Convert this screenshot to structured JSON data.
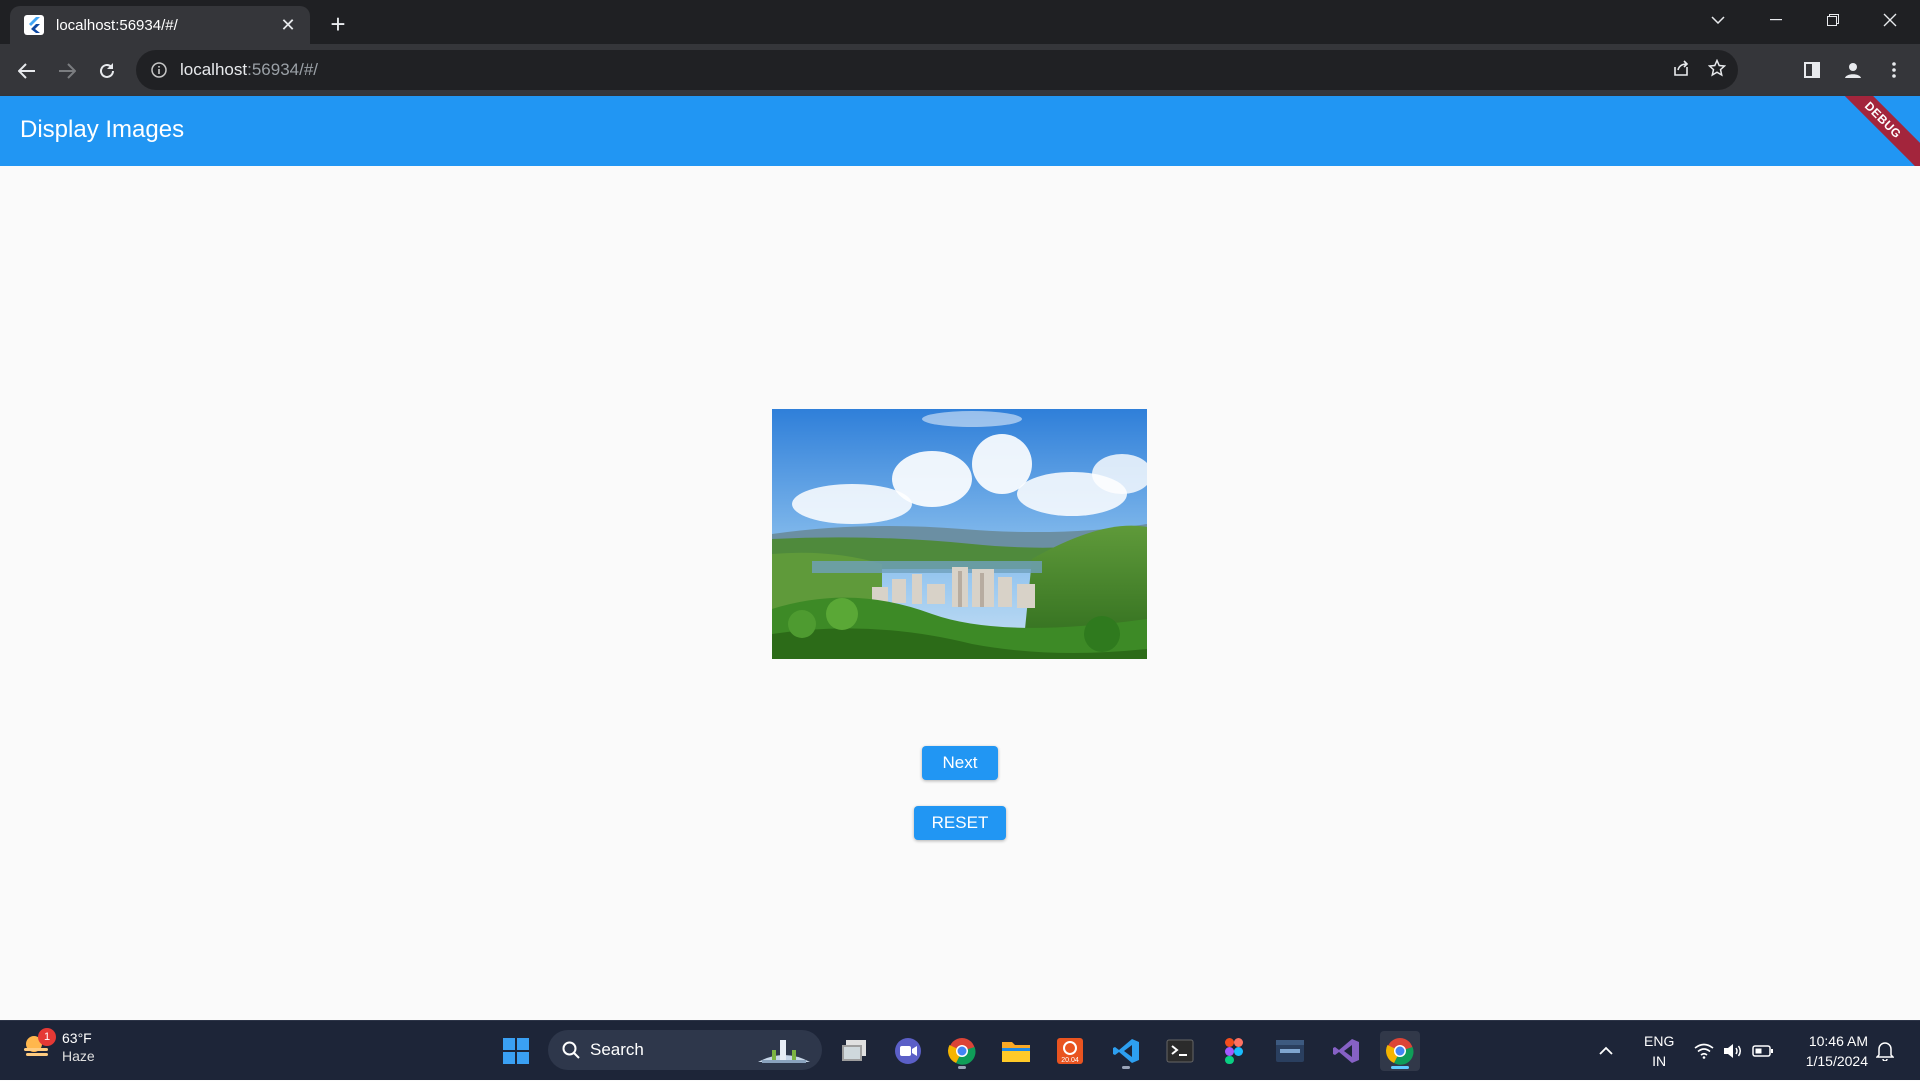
{
  "browser": {
    "tab_title": "localhost:56934/#/",
    "url_host": "localhost",
    "url_rest": ":56934/#/"
  },
  "app": {
    "title": "Display Images",
    "debug_banner": "DEBUG",
    "accent_color": "#2196f3",
    "next_label": "Next",
    "reset_label": "RESET"
  },
  "taskbar": {
    "weather_temp": "63°F",
    "weather_condition": "Haze",
    "weather_badge": "1",
    "search_label": "Search",
    "lang_line1": "ENG",
    "lang_line2": "IN",
    "time": "10:46 AM",
    "date": "1/15/2024",
    "ubuntu_badge": "20.04",
    "pinned": [
      "file-explorer-icon",
      "zoom-icon",
      "chrome-icon",
      "folder-icon",
      "ubuntu-icon",
      "vscode-icon",
      "terminal-icon",
      "figma-icon",
      "mysql-workbench-icon",
      "visual-studio-icon",
      "chrome-active-icon"
    ]
  }
}
